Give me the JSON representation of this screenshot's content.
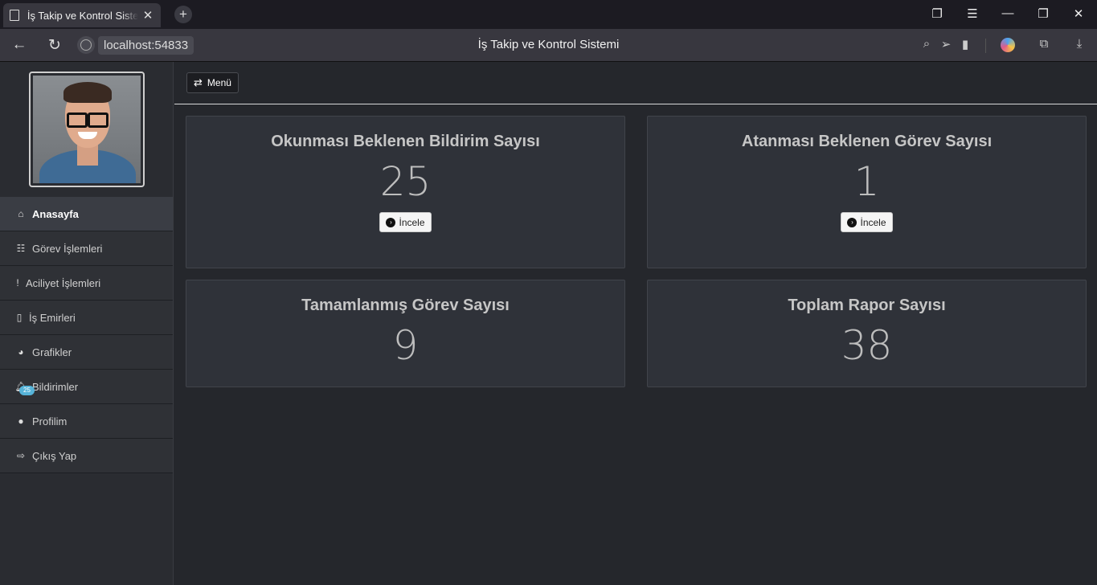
{
  "browser": {
    "tab_title": "İş Takip ve Kontrol Sistemi",
    "url": "localhost:54833",
    "page_title": "İş Takip ve Kontrol Sistemi"
  },
  "sidebar": {
    "items": [
      {
        "label": "Anasayfa",
        "icon": "home-icon"
      },
      {
        "label": "Görev İşlemleri",
        "icon": "tasks-icon"
      },
      {
        "label": "Aciliyet İşlemleri",
        "icon": "exclamation-icon"
      },
      {
        "label": "İş Emirleri",
        "icon": "file-icon"
      },
      {
        "label": "Grafikler",
        "icon": "pie-chart-icon"
      },
      {
        "label": "Bildirimler",
        "icon": "bell-icon",
        "badge": "25"
      },
      {
        "label": "Profilim",
        "icon": "user-icon"
      },
      {
        "label": "Çıkış Yap",
        "icon": "sign-out-icon"
      }
    ]
  },
  "topbar": {
    "menu_label": "Menü"
  },
  "cards": [
    {
      "title": "Okunması Beklenen Bildirim Sayısı",
      "value": "25",
      "button": "İncele"
    },
    {
      "title": "Atanması Beklenen Görev Sayısı",
      "value": "1",
      "button": "İncele"
    },
    {
      "title": "Tamamlanmış Görev Sayısı",
      "value": "9"
    },
    {
      "title": "Toplam Rapor Sayısı",
      "value": "38"
    }
  ],
  "colors": {
    "background": "#25272c",
    "card": "#2f3239",
    "badge": "#56b3d8"
  }
}
